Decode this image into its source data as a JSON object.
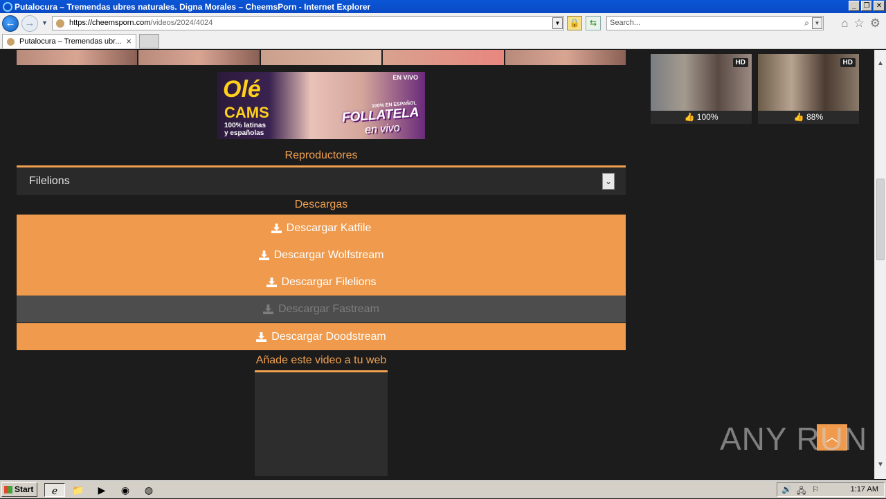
{
  "window": {
    "title": "Putalocura – Tremendas ubres naturales. Digna Morales – CheemsPorn - Internet Explorer"
  },
  "address_bar": {
    "url_host": "https://cheemsporn.com",
    "url_path": "/videos/2024/4024",
    "search_placeholder": "Search..."
  },
  "tab": {
    "label": "Putalocura – Tremendas ubr..."
  },
  "ad": {
    "brand": "Olé",
    "brand2": "CAMS",
    "line1": "100% latinas",
    "line2": "y españolas",
    "live": "EN VIVO",
    "spanish": "100% EN ESPAÑOL",
    "headline1": "FOLLATELA",
    "headline2": "en vivo"
  },
  "players": {
    "title": "Reproductores",
    "selected": "Filelions"
  },
  "downloads": {
    "title": "Descargas",
    "items": [
      {
        "label": "Descargar Katfile",
        "enabled": true
      },
      {
        "label": "Descargar Wolfstream",
        "enabled": true
      },
      {
        "label": "Descargar Filelions",
        "enabled": true
      },
      {
        "label": "Descargar Fastream",
        "enabled": false
      },
      {
        "label": "Descargar Doodstream",
        "enabled": true
      }
    ]
  },
  "embed": {
    "title": "Añade este video a tu web"
  },
  "related": [
    {
      "badge": "HD",
      "rating": "100%"
    },
    {
      "badge": "HD",
      "rating": "88%"
    }
  ],
  "watermark": "ANY RUN",
  "taskbar": {
    "start": "Start",
    "clock": "1:17 AM"
  },
  "colors": {
    "accent": "#ef9a4c",
    "page_bg": "#1c1c1c"
  }
}
